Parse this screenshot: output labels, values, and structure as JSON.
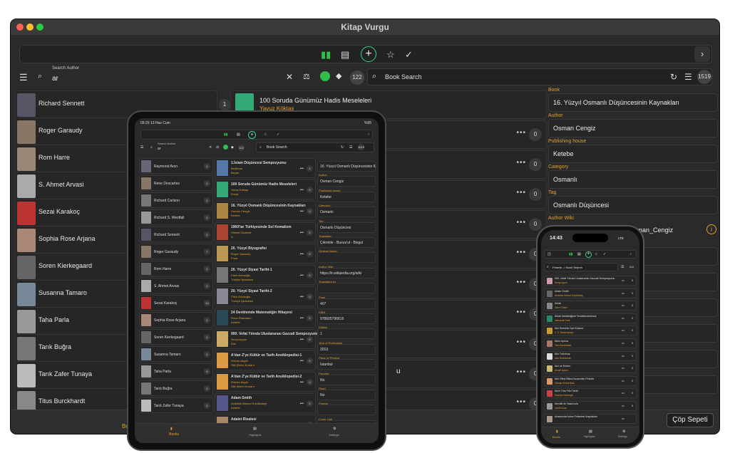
{
  "window": {
    "title": "Kitap Vurgu"
  },
  "search": {
    "author_label": "Search Author",
    "author_value": "ar",
    "author_count": "122",
    "book_placeholder": "Book Search",
    "book_count": "1519"
  },
  "authors": [
    "Richard Sennett",
    "Roger Garaudy",
    "Rom Harre",
    "S. Ahmet Arvasi",
    "Sezai Karakoç",
    "Sophia Rose Arjana",
    "Soren Kierkegaard",
    "Susanna Tamaro",
    "Taha Parla",
    "Tarık Buğra",
    "Tarık Zafer Tunaya",
    "Titus Burckhardt"
  ],
  "books_first": {
    "title": "100 Soruda Günümüz Hadis Meseleleri",
    "author": "Yavuz Köktaş",
    "count": "1"
  },
  "book_counts": [
    "0",
    "0",
    "0",
    "0",
    "0",
    "0",
    "0",
    "0",
    "0",
    "0",
    "0"
  ],
  "book_fragment": "u",
  "details": {
    "book_label": "Book",
    "book": "16. Yüzyıl Osmanlı Düşüncesinin Kaynakları",
    "author_label": "Author",
    "author": "Osman Cengiz",
    "publisher_label": "Publishing house",
    "publisher": "Ketebe",
    "category_label": "Category",
    "category": "Osmanlı",
    "tag_label": "Tag",
    "tag": "Osmanlı Düşüncesi",
    "wiki_label": "Author Wiki",
    "wiki": "https://tr.wikipedia.org/wiki/Osman_Cengiz"
  },
  "tabbar": {
    "trash": "Çöp Sepeti",
    "books_fragment": "Bo"
  },
  "tablet": {
    "status_time": "09:29",
    "status_date": "13 Haz Cum",
    "battery": "%95",
    "author_label": "Search Author",
    "author_value": "ar",
    "author_count": "122",
    "book_placeholder": "Book Search",
    "book_count": "1519",
    "authors": [
      {
        "name": "Raymond Aron",
        "count": "1"
      },
      {
        "name": "Rene Descartes",
        "count": "2"
      },
      {
        "name": "Richard Carlson",
        "count": "1"
      },
      {
        "name": "Richard S. Westfall",
        "count": "1"
      },
      {
        "name": "Richard Sennett",
        "count": "1"
      },
      {
        "name": "Roger Garaudy",
        "count": "7"
      },
      {
        "name": "Rom Harre",
        "count": "1"
      },
      {
        "name": "S. Ahmet Arvasi",
        "count": "2"
      },
      {
        "name": "Sezai Karakoç",
        "count": "14"
      },
      {
        "name": "Sophia Rose Arjana",
        "count": "1"
      },
      {
        "name": "Soren Kierkegaard",
        "count": "1"
      },
      {
        "name": "Susanna Tamaro",
        "count": "1"
      },
      {
        "name": "Taha Parla",
        "count": "6"
      },
      {
        "name": "Tarık Buğra",
        "count": "2"
      },
      {
        "name": "Tarık Zafer Tunaya",
        "count": "1"
      }
    ],
    "books": [
      {
        "title": "1.İslam Düşüncesi Sempozyumu",
        "author": "Bedirhan",
        "pub": "Beyan",
        "count": "1"
      },
      {
        "title": "100 Soruda Günümüz Hadis Meseleleri",
        "author": "Yavuz Köktaş",
        "pub": "Ensar",
        "count": "0"
      },
      {
        "title": "16. Yüzyıl Osmanlı Düşüncesinin Kaynakları",
        "author": "Osman Cengiz",
        "pub": "Ketebe",
        "count": "0"
      },
      {
        "title": "1960'lar Türkiyesinde Sol Kemalizm",
        "author": "Hikmet Özdemir",
        "pub": "İz",
        "count": "0"
      },
      {
        "title": "20. Yüzyıl Biyografisi",
        "author": "Roger Garaudy",
        "pub": "Pınar",
        "count": "0"
      },
      {
        "title": "20. Yüzyıl Siyasi Tarihi-1",
        "author": "Fahir Armaoğlu",
        "pub": "Türkiye İşbankası",
        "count": "0"
      },
      {
        "title": "20. Yüzyıl Siyasi Tarihi-2",
        "author": "Fahir Armaoğlu",
        "pub": "Türkiye İşbankası",
        "count": "0"
      },
      {
        "title": "24 Denklemde Matematiğin Hikayesi",
        "author": "Rona Plasmann",
        "pub": "Ketebe",
        "count": "0"
      },
      {
        "title": "900. Vefat Yılında Uluslararası Gazzali Sempozyumu",
        "author": "Sempozyum",
        "pub": "Elar",
        "count": "0"
      },
      {
        "title": "A'dan Z'ye Kültür ve Tarih Ansiklopedisi-1",
        "author": "Rıdvan Akgül",
        "pub": "Sitil Şiirleri Kurtarır",
        "count": "0"
      },
      {
        "title": "A'dan Z'ye Kültür ve Tarih Ansiklopedisi-2",
        "author": "Rıdvan Akgül",
        "pub": "Sitil Şiirleri Kurtarır",
        "count": "0"
      },
      {
        "title": "Adam Smith",
        "author": "Abdullah Mesud Küçükkalay",
        "pub": "Ketebe",
        "count": "0"
      },
      {
        "title": "Adalet Risalesi",
        "author": "",
        "pub": "",
        "count": "0"
      }
    ],
    "details": [
      {
        "label": "",
        "value": "16. Yüzyıl Osmanlı Düşüncesinin K"
      },
      {
        "label": "Author",
        "value": "Osman Cengiz"
      },
      {
        "label": "Publishing house",
        "value": "Ketebe"
      },
      {
        "label": "Category",
        "value": "Osmanlı"
      },
      {
        "label": "Tag",
        "value": "Osmanlı Düşüncesi"
      },
      {
        "label": "Translator",
        "value": "Çıkrıkde - Busuu'ul - Bisgul"
      },
      {
        "label": "Original Name",
        "value": ""
      },
      {
        "label": "Author Wiki",
        "value": "https://tr.wikipedia.org/wiki"
      },
      {
        "label": "Translated by",
        "value": ""
      },
      {
        "label": "Page",
        "value": "407"
      },
      {
        "label": "ISBN",
        "value": "978605796616"
      },
      {
        "label": "Edition",
        "value": "1"
      },
      {
        "label": "Year of Publication",
        "value": "2019"
      },
      {
        "label": "Place of Printing",
        "value": "İstanbul"
      },
      {
        "label": "Favorite",
        "value": "No"
      },
      {
        "label": "Read",
        "value": "No"
      },
      {
        "label": "Format",
        "value": ""
      },
      {
        "label": "Cover Link",
        "value": "https://lnus.ab.ket/Logo/HK_8"
      }
    ],
    "tabs": [
      "Books",
      "Highlights",
      "Settings"
    ]
  },
  "phone": {
    "time": "14:43",
    "carrier": "LTE",
    "search": "Felsefe -> Book Search",
    "count": "214",
    "books": [
      {
        "title": "900. Vefat Yılında Uluslararası Gazzali Sempozyumu",
        "sub": "Sempozyum",
        "count": "0"
      },
      {
        "title": "Adam Smith",
        "sub": "Abdullah Mesud Küçükkalay",
        "count": "0"
      },
      {
        "title": "Ahlak",
        "sub": "Ömer Türker",
        "count": "0"
      },
      {
        "title": "Ahlak Metafiziğinin Temellendirilmesi",
        "sub": "Immanuel Kant",
        "count": "0"
      },
      {
        "title": "Akıl Kimseler İçin Kılavuz",
        "sub": "C. E. Bahçesaraylı",
        "count": "0"
      },
      {
        "title": "Aklın Ayrıca",
        "sub": "Titus Burckhardt",
        "count": "0"
      },
      {
        "title": "Aklı Tutulmuş",
        "sub": "Max Horkheimer",
        "count": "0"
      },
      {
        "title": "Akıl ve Erdem",
        "sub": "Ahmet Aycan",
        "count": "0"
      },
      {
        "title": "Akıl Ötesi Bilinci Açısından Felsefe",
        "sub": "Osman Kemal Balcı",
        "count": "0"
      },
      {
        "title": "Akıllı Türk Fikri Tarihi",
        "sub": "Zeynep Hezaroglu",
        "count": "0"
      },
      {
        "title": "Alevilik ile Tasavvufa",
        "sub": "Cahit Kosar",
        "count": "0"
      },
      {
        "title": "Anadoluda İslam Felsefesi Kaynakları",
        "sub": "",
        "count": ""
      }
    ],
    "tabs": [
      "Books",
      "Highlights",
      "Settings"
    ]
  },
  "colors": {
    "accent_green": "#2fbf4a",
    "label_orange": "#e0a030",
    "background": "#2a2a2a"
  }
}
